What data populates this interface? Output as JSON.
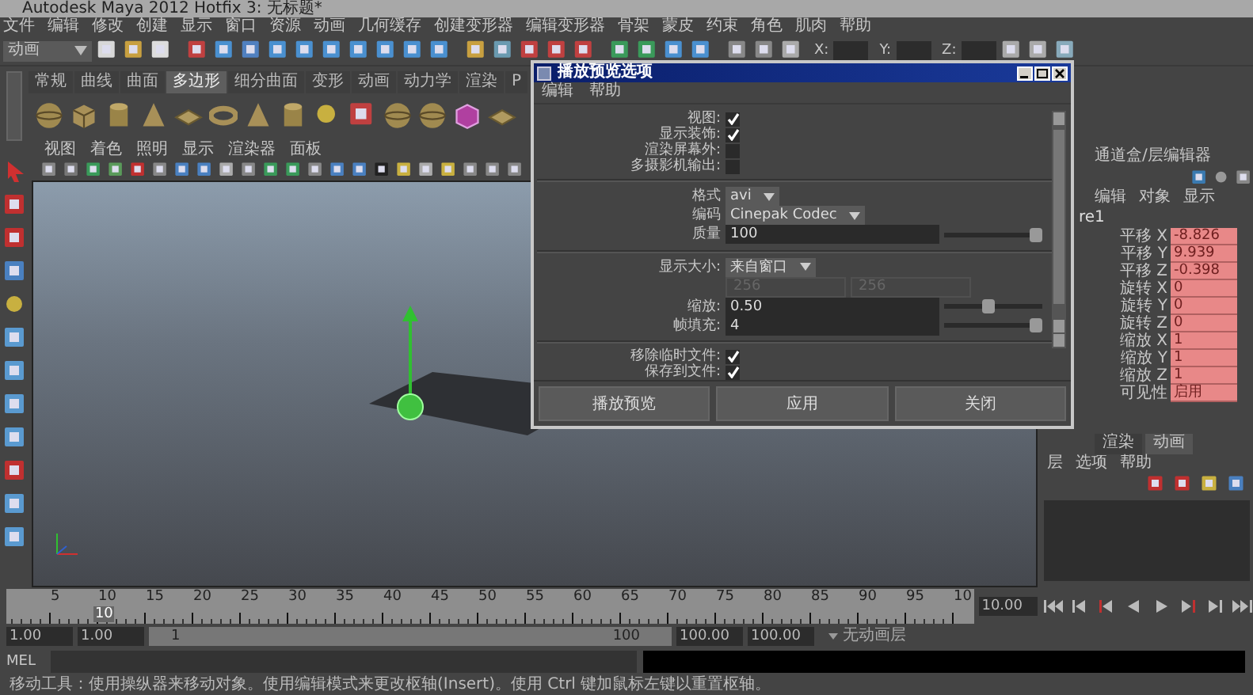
{
  "window": {
    "title": "Autodesk Maya 2012 Hotfix 3: 无标题*"
  },
  "menu_bar": [
    "文件",
    "编辑",
    "修改",
    "创建",
    "显示",
    "窗口",
    "资源",
    "动画",
    "几何缓存",
    "创建变形器",
    "编辑变形器",
    "骨架",
    "蒙皮",
    "约束",
    "角色",
    "肌肉",
    "帮助"
  ],
  "status_line": {
    "mode": "动画",
    "coords": [
      "X:",
      "Y:",
      "Z:"
    ]
  },
  "shelf": {
    "tabs": [
      {
        "label": "常规",
        "selected": false
      },
      {
        "label": "曲线",
        "selected": false
      },
      {
        "label": "曲面",
        "selected": false
      },
      {
        "label": "多边形",
        "selected": true
      },
      {
        "label": "细分曲面",
        "selected": false
      },
      {
        "label": "变形",
        "selected": false
      },
      {
        "label": "动画",
        "selected": false
      },
      {
        "label": "动力学",
        "selected": false
      },
      {
        "label": "渲染",
        "selected": false
      },
      {
        "label": "P",
        "selected": false
      }
    ]
  },
  "viewport": {
    "menus": [
      "视图",
      "着色",
      "照明",
      "显示",
      "渲染器",
      "面板"
    ]
  },
  "channel_box": {
    "title": "通道盒/层编辑器",
    "menus": [
      "编辑",
      "对象",
      "显示"
    ],
    "object": "re1",
    "attributes": [
      {
        "name": "平移 X",
        "value": "-8.826"
      },
      {
        "name": "平移 Y",
        "value": "9.939"
      },
      {
        "name": "平移 Z",
        "value": "-0.398"
      },
      {
        "name": "旋转 X",
        "value": "0"
      },
      {
        "name": "旋转 Y",
        "value": "0"
      },
      {
        "name": "旋转 Z",
        "value": "0"
      },
      {
        "name": "缩放 X",
        "value": "1"
      },
      {
        "name": "缩放 Y",
        "value": "1"
      },
      {
        "name": "缩放 Z",
        "value": "1"
      },
      {
        "name": "可见性",
        "value": "启用"
      }
    ]
  },
  "layer_editor": {
    "tabs": [
      {
        "label": "渲染",
        "selected": false
      },
      {
        "label": "动画",
        "selected": true
      }
    ],
    "menus": [
      "层",
      "选项",
      "帮助"
    ]
  },
  "dialog": {
    "title": "播放预览选项",
    "menus": [
      "编辑",
      "帮助"
    ],
    "rows": [
      {
        "kind": "check",
        "label": "视图:",
        "checked": true
      },
      {
        "kind": "check",
        "label": "显示装饰:",
        "checked": true
      },
      {
        "kind": "check",
        "label": "渲染屏幕外:",
        "checked": false
      },
      {
        "kind": "check",
        "label": "多摄影机输出:",
        "checked": false
      },
      {
        "kind": "divider"
      },
      {
        "kind": "dropdown",
        "label": "格式",
        "value": "avi"
      },
      {
        "kind": "dropdown",
        "label": "编码",
        "value": "Cinepak Codec"
      },
      {
        "kind": "slider",
        "label": "质量",
        "value": "100",
        "level": 1
      },
      {
        "kind": "divider"
      },
      {
        "kind": "dropdown",
        "label": "显示大小:",
        "value": "来自窗口"
      },
      {
        "kind": "pair",
        "values": [
          "256",
          "256"
        ],
        "disabled": true
      },
      {
        "kind": "slider",
        "label": "缩放:",
        "value": "0.50",
        "level": 0.45
      },
      {
        "kind": "slider",
        "label": "帧填充:",
        "value": "4",
        "level": 1
      },
      {
        "kind": "divider"
      },
      {
        "kind": "check",
        "label": "移除临时文件:",
        "checked": true
      },
      {
        "kind": "check",
        "label": "保存到文件:",
        "checked": true
      }
    ],
    "buttons": [
      "播放预览",
      "应用",
      "关闭"
    ]
  },
  "timeline": {
    "labels": [
      "5",
      "10",
      "15",
      "20",
      "25",
      "30",
      "35",
      "40",
      "45",
      "50",
      "55",
      "60",
      "65",
      "70",
      "75",
      "80",
      "85",
      "90",
      "95",
      "10"
    ],
    "current_frame": "10",
    "level": 0.09,
    "time_field": "10.00"
  },
  "range": {
    "start": "1.00",
    "playback_start": "1.00",
    "slider_start": "1",
    "slider_end": "100",
    "level": 1,
    "playback_end": "100.00",
    "end": "100.00",
    "anim_layer": "无动画层"
  },
  "command_line": {
    "label": "MEL"
  },
  "help_line": "移动工具：使用操纵器来移动对象。使用编辑模式来更改枢轴(Insert)。使用 Ctrl 键加鼠标左键以重置枢轴。"
}
